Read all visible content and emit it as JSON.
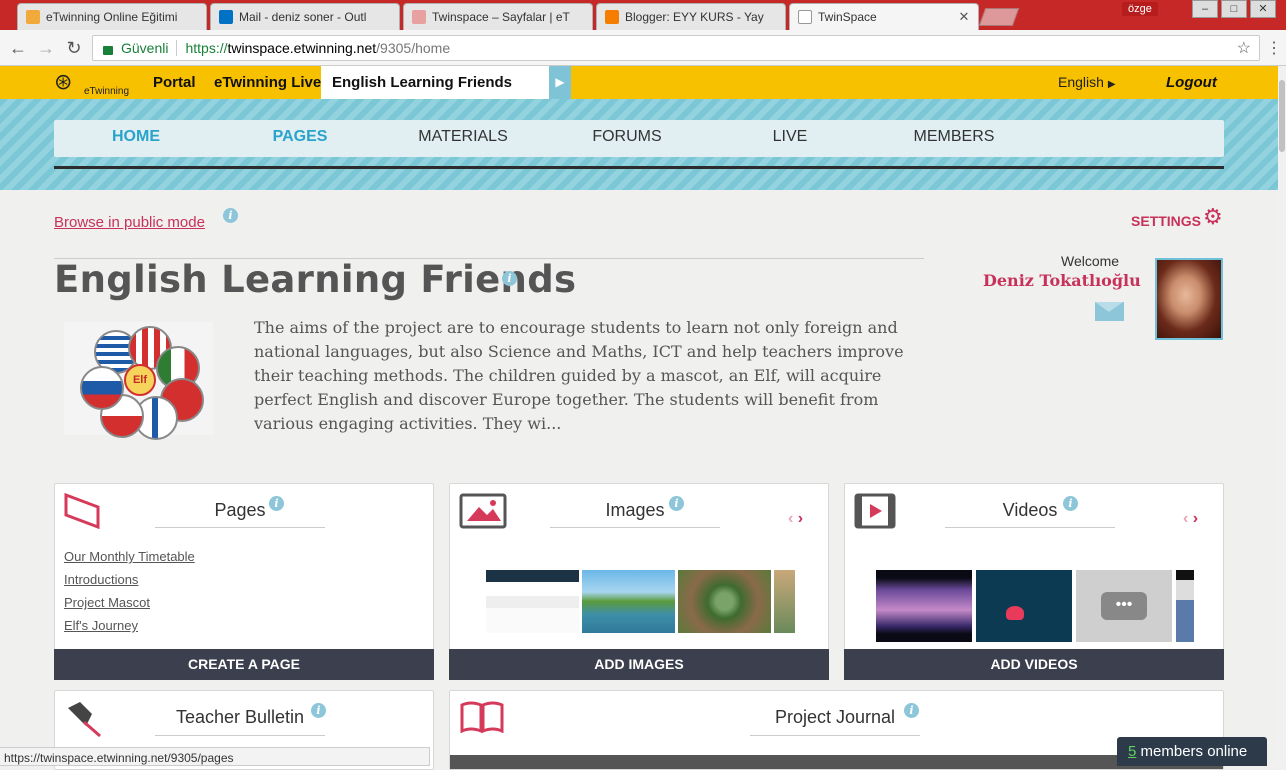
{
  "browser": {
    "tabs": [
      {
        "title": "eTwinning Online Eğitimi",
        "favicon_color": "#f2a93b"
      },
      {
        "title": "Mail - deniz soner - Outl",
        "favicon_color": "#0072c6"
      },
      {
        "title": "Twinspace – Sayfalar | eT",
        "favicon_color": "#e8a0a0"
      },
      {
        "title": "Blogger: EYY KURS - Yay",
        "favicon_color": "#f57d00"
      },
      {
        "title": "TwinSpace",
        "favicon_color": "#ffffff"
      }
    ],
    "user_chip": "özge",
    "secure_label": "Güvenli",
    "url_scheme": "https://",
    "url_host": "twinspace.etwinning.net",
    "url_path": "/9305/home",
    "status_url": "https://twinspace.etwinning.net/9305/pages"
  },
  "topbar": {
    "logo_text": "eTwinning",
    "links": [
      "Portal",
      "eTwinning Live"
    ],
    "project_tab": "English Learning Friends",
    "language": "English",
    "logout": "Logout"
  },
  "nav": {
    "items": [
      "HOME",
      "PAGES",
      "MATERIALS",
      "FORUMS",
      "LIVE",
      "MEMBERS"
    ]
  },
  "page": {
    "browse_link": "Browse in public mode",
    "settings_label": "SETTINGS",
    "title": "English Learning Friends",
    "welcome": "Welcome",
    "user_name": "Deniz Tokatlıoğlu",
    "description": "The aims of the project are to encourage students to learn not only foreign and national languages, but also Science and Maths, ICT and help teachers improve their teaching methods. The children guided by a mascot, an Elf, will acquire perfect English and discover Europe together. The students will benefit from various engaging activities. They wi...",
    "mascot_label": "Elf"
  },
  "cards": {
    "pages": {
      "title": "Pages",
      "links": [
        "Our Monthly Timetable",
        "Introductions",
        "Project Mascot",
        "Elf's Journey"
      ],
      "button": "CREATE A PAGE"
    },
    "images": {
      "title": "Images",
      "button": "ADD IMAGES"
    },
    "videos": {
      "title": "Videos",
      "button": "ADD VIDEOS"
    },
    "bulletin": {
      "title": "Teacher Bulletin"
    },
    "journal": {
      "title": "Project Journal"
    }
  },
  "online": {
    "count": "5",
    "label": "members online"
  },
  "colors": {
    "accent": "#c8315a",
    "topbar": "#f7c100",
    "nav_active": "#29a3cc",
    "button": "#3c3f4e"
  }
}
